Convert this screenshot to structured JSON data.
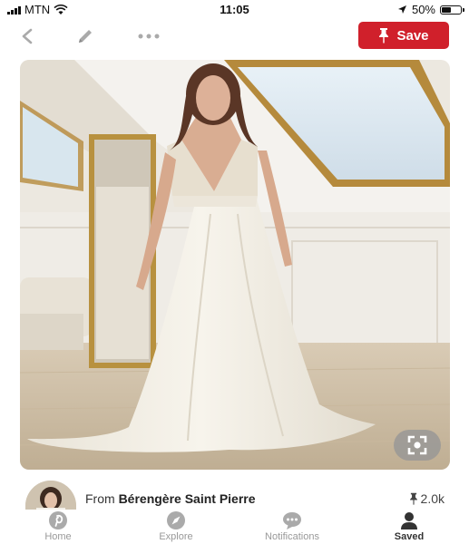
{
  "status_bar": {
    "carrier": "MTN",
    "time": "11:05",
    "battery": "50%",
    "battery_level": 0.5
  },
  "toolbar": {
    "save_label": "Save"
  },
  "pin": {
    "source_prefix": "From",
    "source_name": "Bérengère Saint Pierre",
    "save_count": "2.0k"
  },
  "tabs": [
    {
      "label": "Home",
      "icon": "pinterest-icon"
    },
    {
      "label": "Explore",
      "icon": "compass-icon"
    },
    {
      "label": "Notifications",
      "icon": "chat-bubble-icon"
    },
    {
      "label": "Saved",
      "icon": "person-icon",
      "active": true
    }
  ],
  "colors": {
    "save_button": "#d0202b",
    "tab_inactive": "#999999",
    "tab_active": "#333333"
  }
}
